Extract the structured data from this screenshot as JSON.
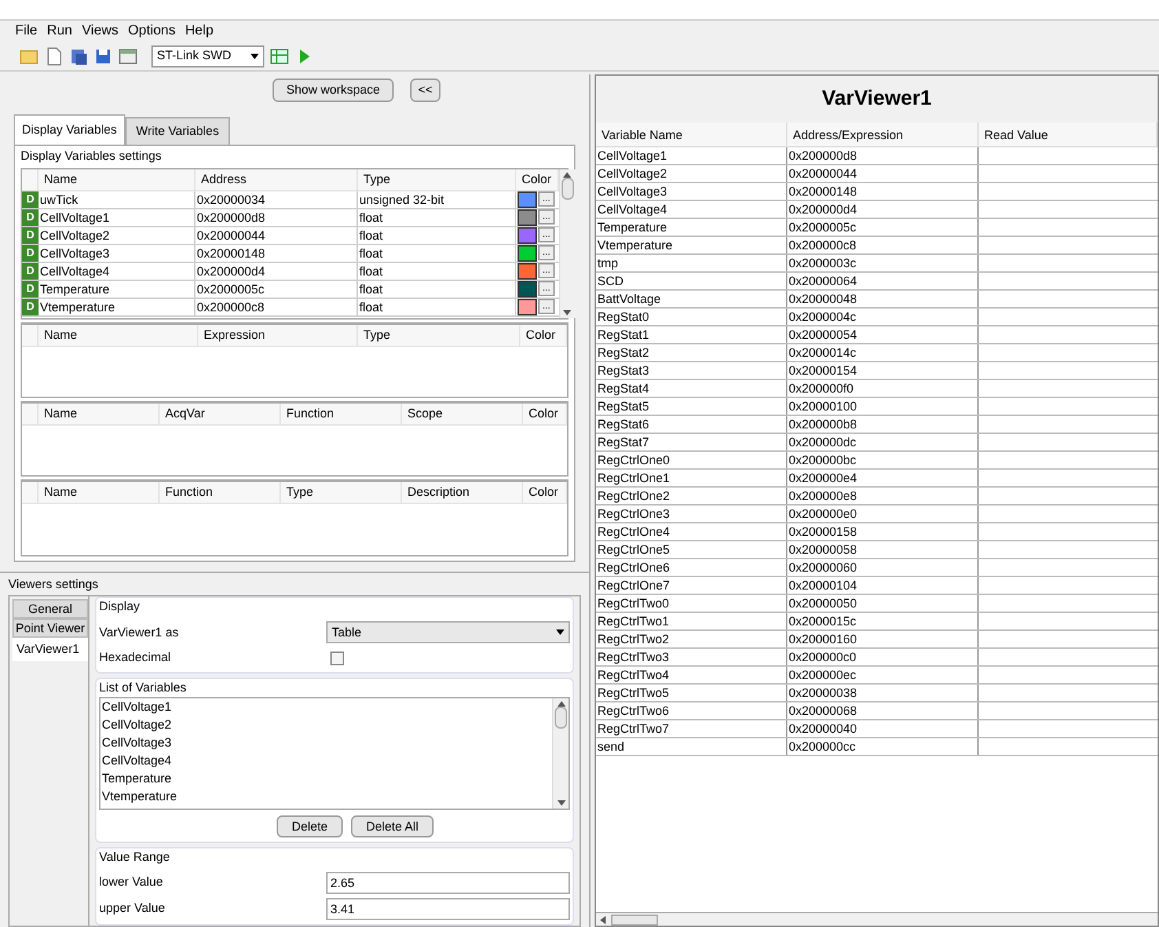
{
  "menu": [
    "File",
    "Run",
    "Views",
    "Options",
    "Help"
  ],
  "toolbar": {
    "connection": "ST-Link SWD"
  },
  "workspace_buttons": [
    "Show workspace",
    "<<"
  ],
  "tabs": [
    {
      "label": "Display Variables",
      "selected": true
    },
    {
      "label": "Write Variables",
      "selected": false
    }
  ],
  "display_settings": {
    "title": "Display Variables settings",
    "variables": {
      "columns": [
        "Name",
        "Address",
        "Type",
        "Color"
      ],
      "rows": [
        {
          "badge": "D",
          "name": "uwTick",
          "address": "0x20000034",
          "type": "unsigned 32-bit",
          "color": "#5b8ff9",
          "more": "..."
        },
        {
          "badge": "D",
          "name": "CellVoltage1",
          "address": "0x200000d8",
          "type": "float",
          "color": "#8c8c8c",
          "more": "..."
        },
        {
          "badge": "D",
          "name": "CellVoltage2",
          "address": "0x20000044",
          "type": "float",
          "color": "#9966ff",
          "more": "..."
        },
        {
          "badge": "D",
          "name": "CellVoltage3",
          "address": "0x20000148",
          "type": "float",
          "color": "#00cc33",
          "more": "..."
        },
        {
          "badge": "D",
          "name": "CellVoltage4",
          "address": "0x200000d4",
          "type": "float",
          "color": "#ff6633",
          "more": "..."
        },
        {
          "badge": "D",
          "name": "Temperature",
          "address": "0x2000005c",
          "type": "float",
          "color": "#005555",
          "more": "..."
        },
        {
          "badge": "D",
          "name": "Vtemperature",
          "address": "0x200000c8",
          "type": "float",
          "color": "#ff9999",
          "more": "..."
        }
      ]
    },
    "other_tables": [
      {
        "columns": [
          "Name",
          "Expression",
          "Type",
          "Color"
        ]
      },
      {
        "columns": [
          "Name",
          "AcqVar",
          "Function",
          "Scope",
          "Color"
        ]
      },
      {
        "columns": [
          "Name",
          "Function",
          "Type",
          "Description",
          "Color"
        ]
      }
    ]
  },
  "viewers_settings": {
    "title": "Viewers settings",
    "tabs": [
      {
        "label": "General",
        "selected": false
      },
      {
        "label": "Point Viewer",
        "selected": false
      },
      {
        "label": "VarViewer1",
        "selected": true
      }
    ],
    "display": {
      "title": "Display",
      "mode_label": "VarViewer1 as",
      "mode_value": "Table",
      "hex_label": "Hexadecimal",
      "hex_checked": false
    },
    "list": {
      "title": "List of Variables",
      "items": [
        "CellVoltage1",
        "CellVoltage2",
        "CellVoltage3",
        "CellVoltage4",
        "Temperature",
        "Vtemperature"
      ],
      "buttons": [
        "Delete",
        "Delete All"
      ]
    },
    "range": {
      "title": "Value Range",
      "lower_label": "lower Value",
      "lower_value": "2.65",
      "upper_label": "upper Value",
      "upper_value": "3.41"
    }
  },
  "viewer": {
    "title": "VarViewer1",
    "columns": [
      "Variable Name",
      "Address/Expression",
      "Read Value"
    ],
    "rows": [
      {
        "name": "CellVoltage1",
        "address": "0x200000d8"
      },
      {
        "name": "CellVoltage2",
        "address": "0x20000044"
      },
      {
        "name": "CellVoltage3",
        "address": "0x20000148"
      },
      {
        "name": "CellVoltage4",
        "address": "0x200000d4"
      },
      {
        "name": "Temperature",
        "address": "0x2000005c"
      },
      {
        "name": "Vtemperature",
        "address": "0x200000c8"
      },
      {
        "name": "tmp",
        "address": "0x2000003c"
      },
      {
        "name": "SCD",
        "address": "0x20000064"
      },
      {
        "name": "BattVoltage",
        "address": "0x20000048"
      },
      {
        "name": "RegStat0",
        "address": "0x2000004c"
      },
      {
        "name": "RegStat1",
        "address": "0x20000054"
      },
      {
        "name": "RegStat2",
        "address": "0x2000014c"
      },
      {
        "name": "RegStat3",
        "address": "0x20000154"
      },
      {
        "name": "RegStat4",
        "address": "0x200000f0"
      },
      {
        "name": "RegStat5",
        "address": "0x20000100"
      },
      {
        "name": "RegStat6",
        "address": "0x200000b8"
      },
      {
        "name": "RegStat7",
        "address": "0x200000dc"
      },
      {
        "name": "RegCtrlOne0",
        "address": "0x200000bc"
      },
      {
        "name": "RegCtrlOne1",
        "address": "0x200000e4"
      },
      {
        "name": "RegCtrlOne2",
        "address": "0x200000e8"
      },
      {
        "name": "RegCtrlOne3",
        "address": "0x200000e0"
      },
      {
        "name": "RegCtrlOne4",
        "address": "0x20000158"
      },
      {
        "name": "RegCtrlOne5",
        "address": "0x20000058"
      },
      {
        "name": "RegCtrlOne6",
        "address": "0x20000060"
      },
      {
        "name": "RegCtrlOne7",
        "address": "0x20000104"
      },
      {
        "name": "RegCtrlTwo0",
        "address": "0x20000050"
      },
      {
        "name": "RegCtrlTwo1",
        "address": "0x2000015c"
      },
      {
        "name": "RegCtrlTwo2",
        "address": "0x20000160"
      },
      {
        "name": "RegCtrlTwo3",
        "address": "0x200000c0"
      },
      {
        "name": "RegCtrlTwo4",
        "address": "0x200000ec"
      },
      {
        "name": "RegCtrlTwo5",
        "address": "0x20000038"
      },
      {
        "name": "RegCtrlTwo6",
        "address": "0x20000068"
      },
      {
        "name": "RegCtrlTwo7",
        "address": "0x20000040"
      },
      {
        "name": "send",
        "address": "0x200000cc"
      }
    ]
  }
}
